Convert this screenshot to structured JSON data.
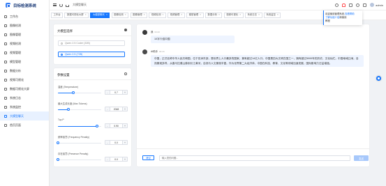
{
  "app": {
    "title": "目标检测系统",
    "username": "admin"
  },
  "sidebar": {
    "items": [
      {
        "label": "工作台",
        "icon": "dashboard-icon",
        "active": false
      },
      {
        "label": "图像检测",
        "icon": "image-icon",
        "active": false
      },
      {
        "label": "图像管理",
        "icon": "folder-icon",
        "active": false
      },
      {
        "label": "视频检测",
        "icon": "video-icon",
        "active": false
      },
      {
        "label": "视频管理",
        "icon": "film-icon",
        "active": false
      },
      {
        "label": "模型管理",
        "icon": "cube-icon",
        "active": false
      },
      {
        "label": "数据分析",
        "icon": "chart-icon",
        "active": false
      },
      {
        "label": "视频可视化",
        "icon": "screen-icon",
        "active": false
      },
      {
        "label": "数据可视化大屏",
        "icon": "monitor-icon",
        "active": false
      },
      {
        "label": "系统日志",
        "icon": "log-icon",
        "active": false
      },
      {
        "label": "系统监控",
        "icon": "cpu-icon",
        "active": false
      },
      {
        "label": "大模型聊天",
        "icon": "chat-icon",
        "active": true
      },
      {
        "label": "首页页面",
        "icon": "home-icon",
        "active": false
      }
    ]
  },
  "header": {
    "breadcrumb": "大模型聊天"
  },
  "tabs": [
    {
      "label": "工作台",
      "active": false,
      "closable": false
    },
    {
      "label": "数据可视化大屏",
      "active": false,
      "closable": true
    },
    {
      "label": "大模型聊天",
      "active": true,
      "closable": true
    },
    {
      "label": "图像检测",
      "active": false,
      "closable": true
    },
    {
      "label": "图像管理",
      "active": false,
      "closable": true
    },
    {
      "label": "视频检测",
      "active": false,
      "closable": true
    },
    {
      "label": "视频管理",
      "active": false,
      "closable": true
    },
    {
      "label": "模型管理",
      "active": false,
      "closable": true
    },
    {
      "label": "数据分析",
      "active": false,
      "closable": true
    },
    {
      "label": "视频可视化",
      "active": false,
      "closable": true
    },
    {
      "label": "系统日志",
      "active": false,
      "closable": true
    },
    {
      "label": "系统监控",
      "active": false,
      "closable": true
    }
  ],
  "tab_close_glyph": "×",
  "notification": {
    "line1_prefix": "欢迎使用管理系统,",
    "line1_link": "查看帮助",
    "line2_prefix": "",
    "line2_link": "了解功能介绍",
    "line2_suffix": "和使用",
    "line3": "教程"
  },
  "model_panel": {
    "title": "大模型选择",
    "options": [
      {
        "label": "Qwen 2.5 Coder (32B)",
        "selected": false
      },
      {
        "label": "Qwen 2.5 (72B)",
        "selected": true
      }
    ]
  },
  "params_panel": {
    "title": "参数设置",
    "params": [
      {
        "label": "温度 (Temperature)",
        "value": "0.7",
        "fraction": 0.35
      },
      {
        "label": "最大生成长度 (Max Tokens)",
        "value": "2048",
        "fraction": 0.24
      },
      {
        "label": "Top P",
        "value": "0.90",
        "fraction": 0.9
      },
      {
        "label": "频率惩罚 (Frequency Penalty)",
        "value": "0.0",
        "fraction": 0.0
      },
      {
        "label": "存在惩罚 (Presence Penalty)",
        "value": "0.0",
        "fraction": 0.0
      }
    ],
    "minus": "-",
    "plus": "+"
  },
  "chat": {
    "messages": [
      {
        "role": "user",
        "name": "我",
        "time": "00:20",
        "text": "10字介绍中国"
      },
      {
        "role": "assistant",
        "name": "AI助手",
        "time": "00:20",
        "text": "中国，正式名称中华人民共和国，位于亚洲东部，是世界上人口最多的国家，拥有超过14亿人口。中国是四大文明古国之一，拥有超过5000年的历史，文化灿烂。中国地域辽阔，自然景观多样，从喜马拉雅山脉到长江黄河，自然与人文景观丰富。作为世界第二大经济体，中国在科技、教育、文化等领域迅速发展，国际影响力日益增强。"
      }
    ],
    "clear_label": "清空",
    "input_placeholder": "输入您的问题...",
    "send_label": "发送"
  },
  "colors": {
    "accent": "#1677ff",
    "bubble": "#eef4ff",
    "user_avatar": "#3a3a3a",
    "ai_avatar": "#4a4a4a"
  }
}
